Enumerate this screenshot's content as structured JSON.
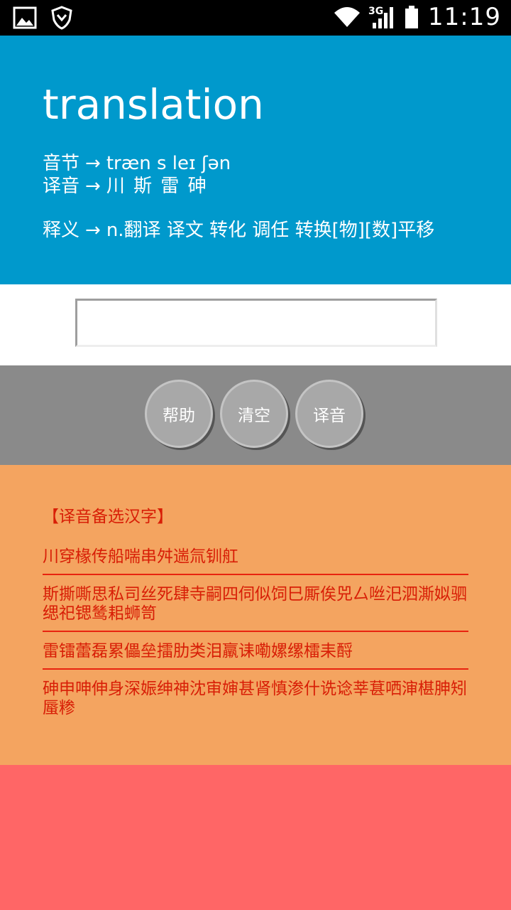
{
  "status_bar": {
    "time": "11:19",
    "network": "3G",
    "icons": [
      "image-icon",
      "shield-icon",
      "wifi-icon",
      "signal-icon",
      "battery-icon"
    ]
  },
  "header": {
    "word": "translation",
    "syllable_label": "音节",
    "syllable_value": "træn s leɪ ʃən",
    "transliteration_label": "译音",
    "transliteration_value": "川 斯 雷 砷",
    "definition_label": "释义",
    "definition_value": "n.翻译 译文 转化 调任 转换[物][数]平移",
    "arrow": "→"
  },
  "input": {
    "value": "",
    "placeholder": ""
  },
  "buttons": {
    "help": "帮助",
    "clear": "清空",
    "transliterate": "译音"
  },
  "candidates": {
    "title": "【译音备选汉字】",
    "items": [
      "川穿椽传船喘串舛遄氚钏舡",
      "斯撕嘶思私司丝死肆寺嗣四伺似饲巳厮俟兕厶咝汜泗澌姒驷缌祀锶鸶耜蛳笥",
      "雷镭蕾磊累儡垒擂肋类泪羸诔嘞嫘缧檑耒酹",
      "砷申呻伸身深娠绅神沈审婶甚肾慎渗什诜谂莘葚哂渖椹胂矧蜃糁"
    ]
  },
  "colors": {
    "status_bar": "#000000",
    "header": "#0099cc",
    "button_bar": "#8a8a8a",
    "result_panel": "#f4a460",
    "bottom": "#ff6666",
    "candidate_text": "#d81e06"
  }
}
